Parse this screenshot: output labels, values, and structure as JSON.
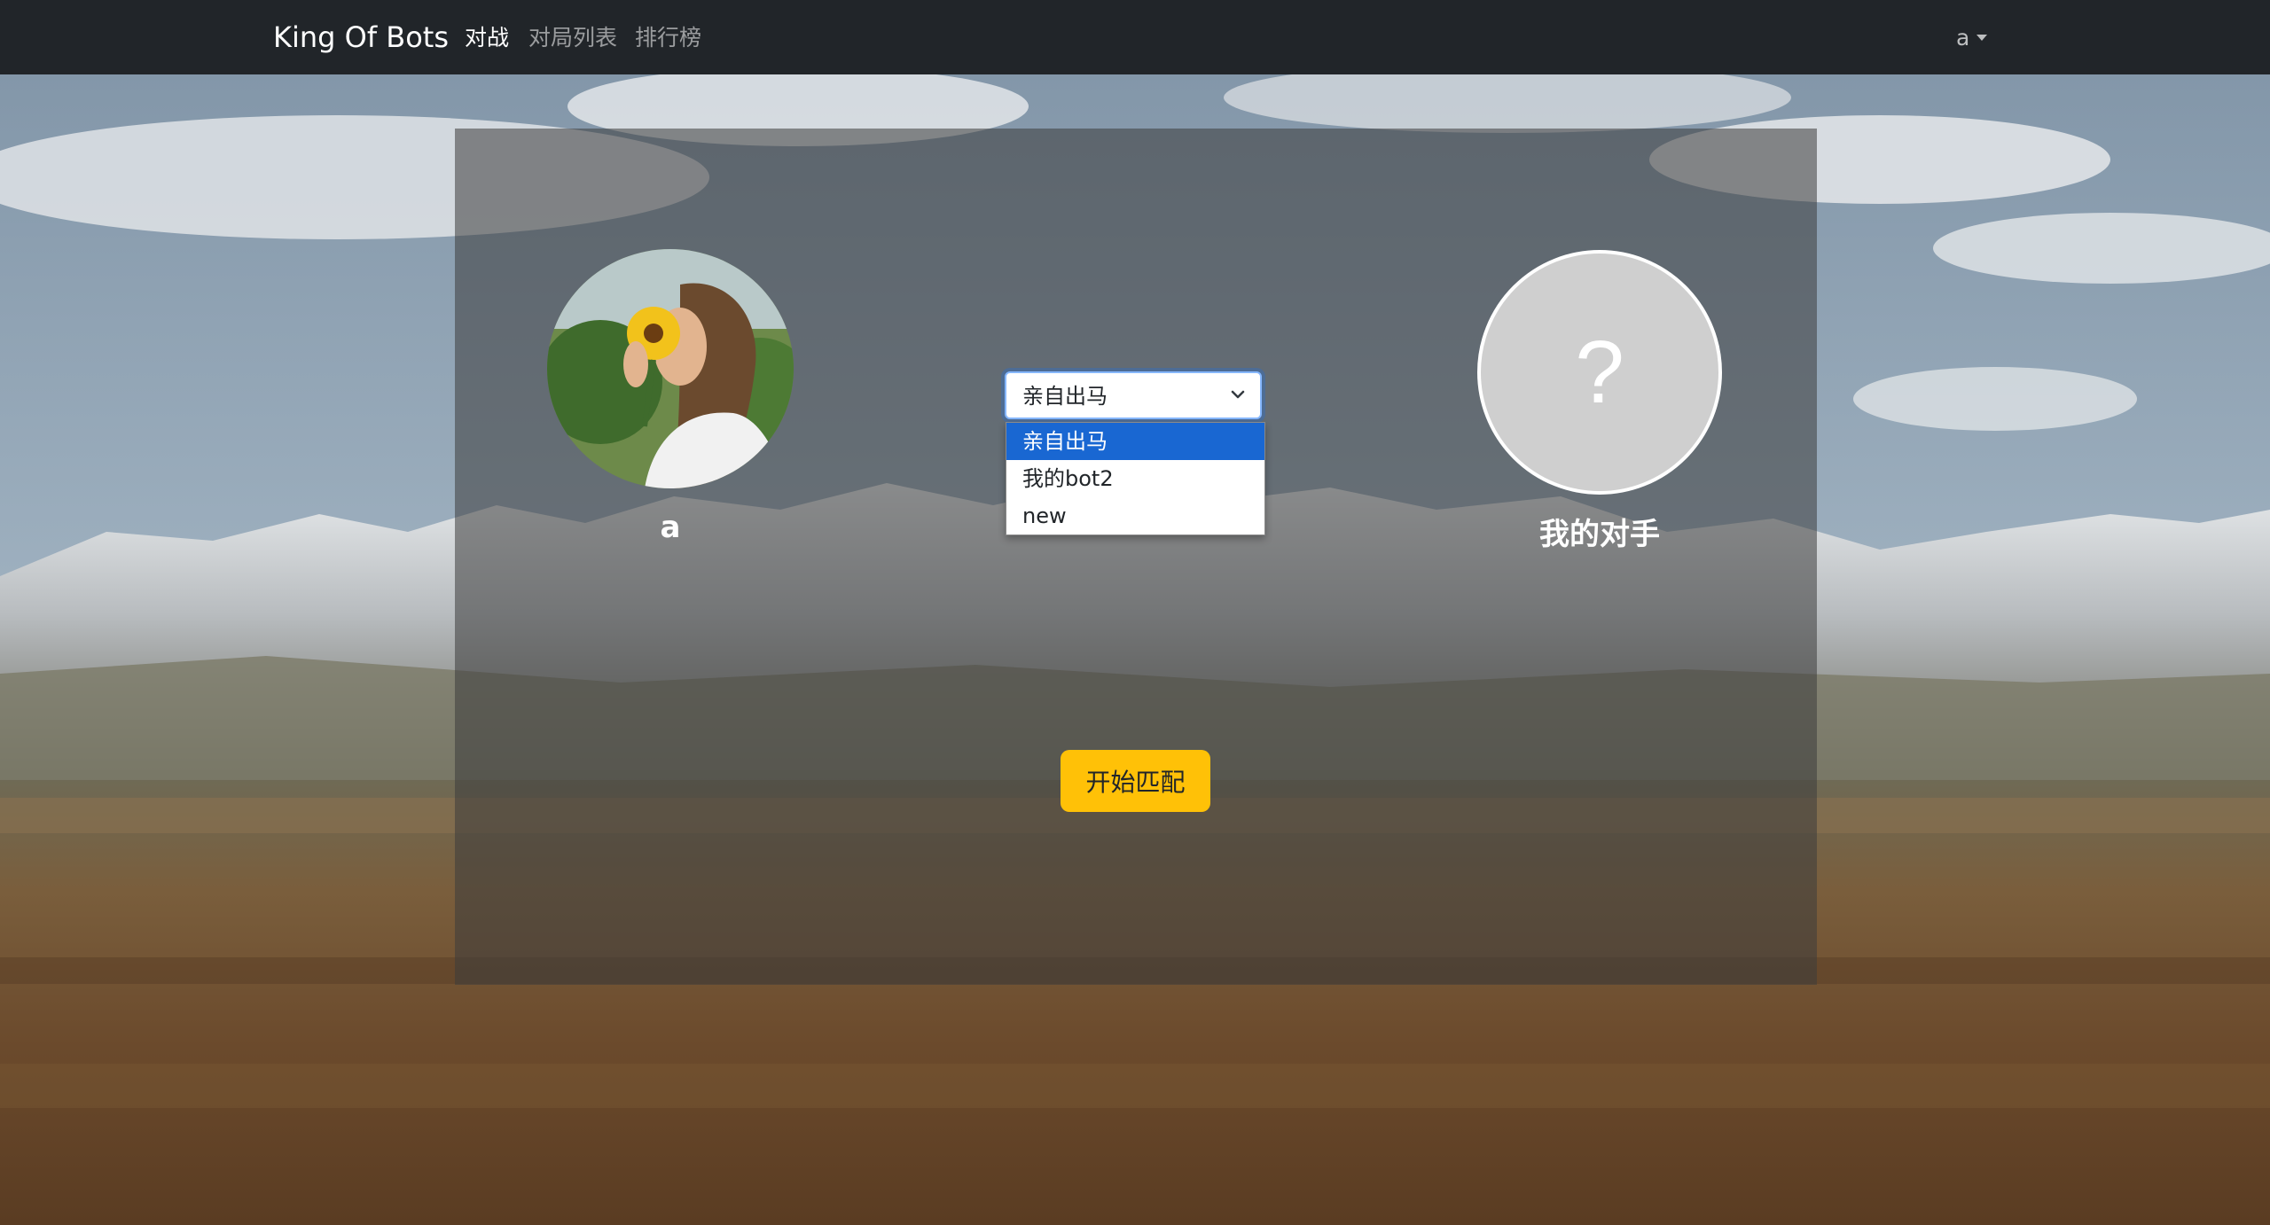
{
  "navbar": {
    "brand": "King Of Bots",
    "links": [
      {
        "label": "对战",
        "active": true
      },
      {
        "label": "对局列表",
        "active": false
      },
      {
        "label": "排行榜",
        "active": false
      }
    ],
    "user": "a"
  },
  "player": {
    "name": "a"
  },
  "opponent": {
    "name": "我的对手",
    "placeholder": "?"
  },
  "bot_select": {
    "selected": "亲自出马",
    "options": [
      "亲自出马",
      "我的bot2",
      "new"
    ]
  },
  "start_button": {
    "label": "开始匹配"
  },
  "colors": {
    "navbar_bg": "#212529",
    "accent_button": "#ffc107",
    "option_highlight": "#1967d2"
  }
}
